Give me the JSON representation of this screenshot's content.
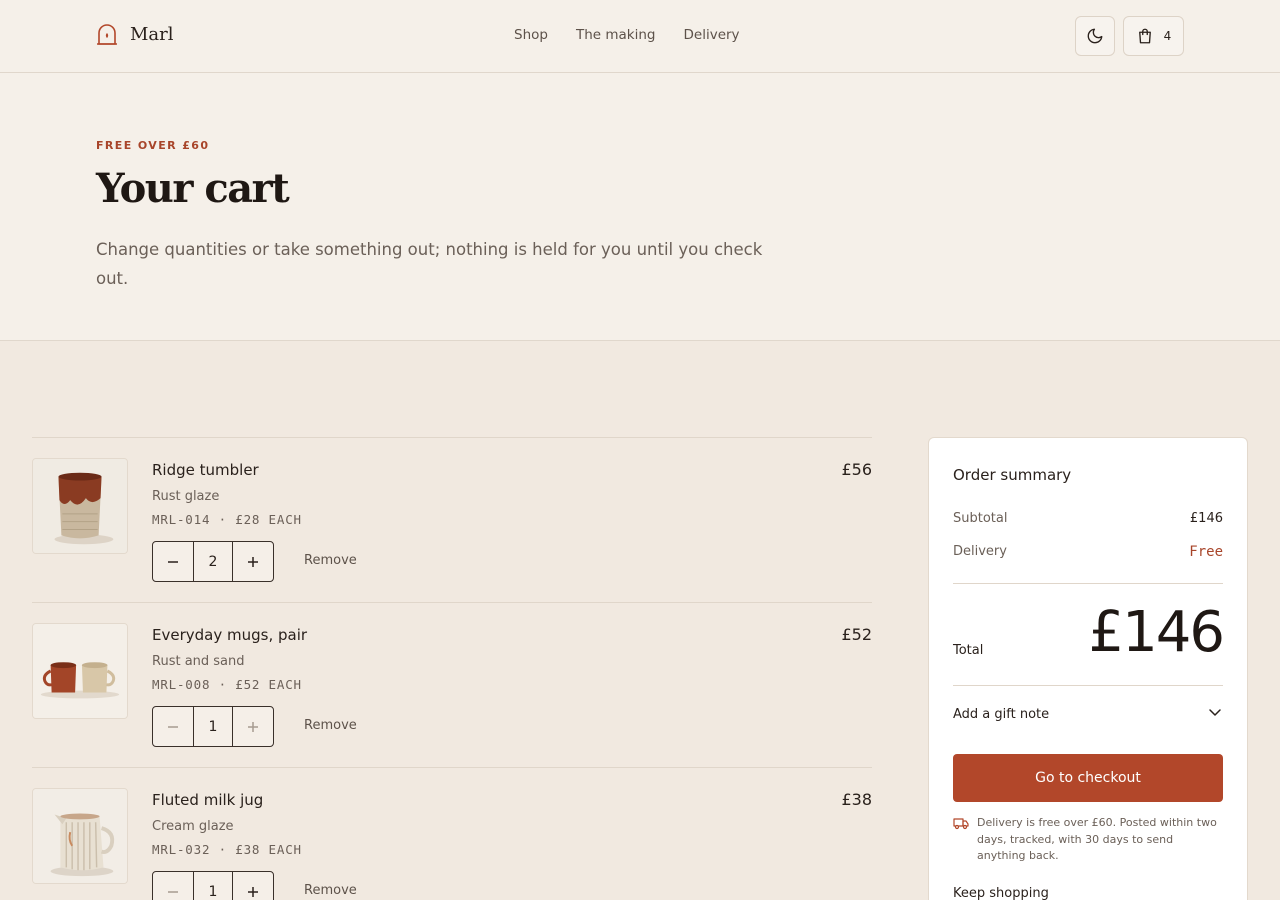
{
  "header": {
    "brand": "Marl",
    "nav": [
      "Shop",
      "The making",
      "Delivery"
    ],
    "cart_count": "4",
    "icons": {
      "theme": "moon-icon",
      "cart": "shopping-bag-icon",
      "logo": "kiln-icon"
    }
  },
  "hero": {
    "eyebrow": "FREE OVER £60",
    "title": "Your cart",
    "lead": "Change quantities or take something out; nothing is held for you until you check out."
  },
  "items": [
    {
      "name": "Ridge tumbler",
      "variant": "Rust glaze",
      "sku": "MRL-014 · £28 EACH",
      "qty": "2",
      "price": "£56",
      "remove": "Remove",
      "decrement_disabled": false
    },
    {
      "name": "Everyday mugs, pair",
      "variant": "Rust and sand",
      "sku": "MRL-008 · £52 EACH",
      "qty": "1",
      "price": "£52",
      "remove": "Remove",
      "decrement_disabled": true
    },
    {
      "name": "Fluted milk jug",
      "variant": "Cream glaze",
      "sku": "MRL-032 · £38 EACH",
      "qty": "1",
      "price": "£38",
      "remove": "Remove",
      "decrement_disabled": true
    }
  ],
  "summary": {
    "title": "Order summary",
    "subtotal_label": "Subtotal",
    "subtotal": "£146",
    "delivery_label": "Delivery",
    "delivery": "Free",
    "total_label": "Total",
    "total": "£146",
    "gift_note": "Add a gift note",
    "checkout": "Go to checkout",
    "note": "Delivery is free over £60. Posted within two days, tracked, with 30 days to send anything back.",
    "keep_shopping": "Keep shopping"
  },
  "colors": {
    "accent": "#b2472a",
    "background": "#f5f0e9",
    "panel": "#f1e9e0"
  }
}
